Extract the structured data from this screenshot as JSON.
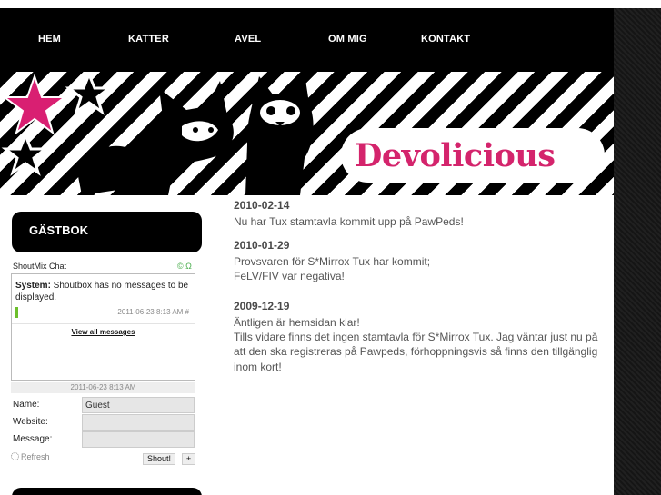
{
  "nav": {
    "items": [
      {
        "label": "HEM"
      },
      {
        "label": "KATTER"
      },
      {
        "label": "AVEL"
      },
      {
        "label": "OM MIG"
      },
      {
        "label": "KONTAKT"
      }
    ]
  },
  "banner": {
    "brand": "Devolicious"
  },
  "sidebar": {
    "title": "GÄSTBOK",
    "shoutmix": {
      "title": "ShoutMix Chat",
      "icons": "© Ω",
      "message_sender": "System:",
      "message_text": " Shoutbox has no messages to be displayed.",
      "message_time": "2011-06-23 8:13 AM #",
      "view_all": "View all messages",
      "last_time": "2011-06-23 8:13 AM",
      "form": {
        "name_label": "Name:",
        "name_value": "Guest",
        "website_label": "Website:",
        "message_label": "Message:",
        "refresh_label": "Refresh",
        "shout_label": "Shout!",
        "plus_label": "+"
      }
    }
  },
  "posts": [
    {
      "date": "2010-02-14",
      "lines": [
        "Nu har Tux stamtavla kommit upp på PawPeds!"
      ]
    },
    {
      "date": "2010-01-29",
      "lines": [
        "Provsvaren för S*Mirrox Tux har kommit;",
        "FeLV/FIV var negativa!"
      ]
    },
    {
      "date": "2009-12-19",
      "lines": [
        "Äntligen är hemsidan klar!",
        "Tills vidare finns det ingen stamtavla för S*Mirrox Tux. Jag väntar just nu på",
        "att den ska registreras på Pawpeds, förhoppningsvis så finns den tillgänglig",
        "inom kort!"
      ]
    }
  ],
  "colors": {
    "brand": "#d4246c",
    "nav_bg": "#000000",
    "star_pink": "#d91f72"
  }
}
